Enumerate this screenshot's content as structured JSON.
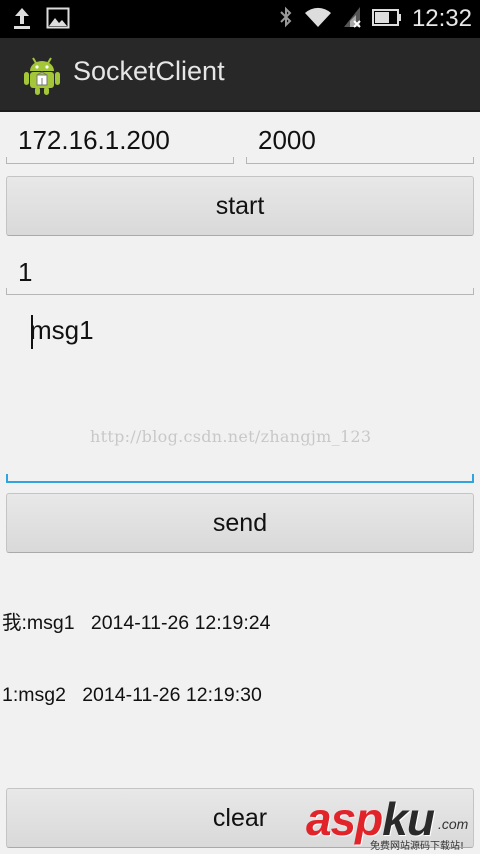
{
  "status_bar": {
    "time": "12:32",
    "icons": [
      "upload-icon",
      "image-icon",
      "bluetooth-icon",
      "wifi-icon",
      "signal-icon",
      "battery-icon"
    ]
  },
  "action_bar": {
    "title": "SocketClient",
    "logo": "android-icon"
  },
  "form": {
    "ip_value": "172.16.1.200",
    "port_value": "2000",
    "start_label": "start",
    "target_value": "1",
    "message_value": "msg1",
    "send_label": "send",
    "clear_label": "clear"
  },
  "log": {
    "lines": [
      "我:msg1   2014-11-26 12:19:24",
      "1:msg2   2014-11-26 12:19:30"
    ]
  },
  "watermark": "http://blog.csdn.net/zhangjm_123",
  "branding": {
    "name_part1": "asp",
    "name_part2": "ku",
    "domain": ".com",
    "tagline": "免费网站源码下载站!"
  },
  "colors": {
    "accent": "#33a3e0",
    "brand_red": "#e0242a"
  }
}
